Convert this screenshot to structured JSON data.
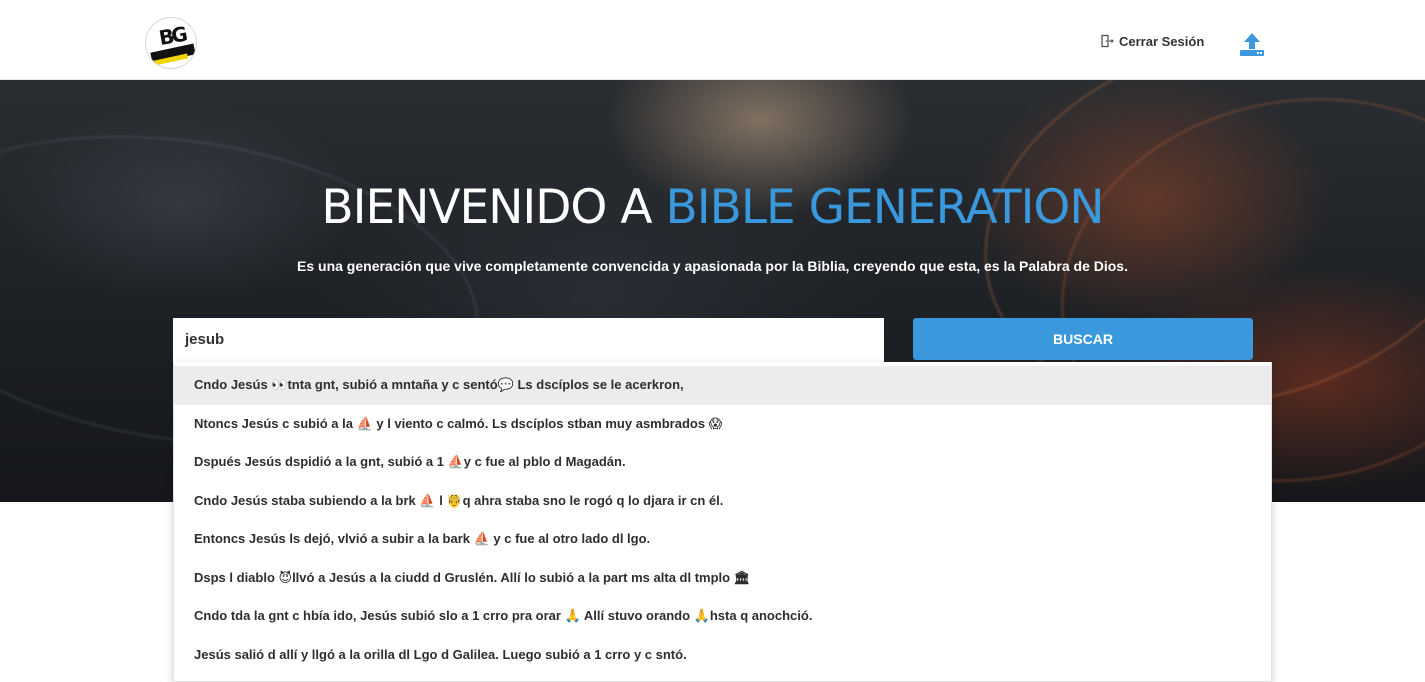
{
  "header": {
    "logo_text": "BG",
    "logout_label": "Cerrar Sesión",
    "logout_icon": "door-exit-icon",
    "upload_icon": "cloud-upload-icon",
    "upload_color": "#3a98dd"
  },
  "hero": {
    "title_main": "BIENVENIDO A",
    "title_accent": "BIBLE GENERATION",
    "accent_color": "#3a98dd",
    "subtitle": "Es una generación que vive completamente convencida y apasionada por la Biblia, creyendo que esta, es la Palabra de Dios."
  },
  "search": {
    "value": "jesub",
    "button_label": "BUSCAR",
    "button_color": "#3a98dd"
  },
  "suggestions": [
    "Cndo Jesús 👀tnta gnt, subió a mntaña y c sentó💬   Ls dscíplos se le acerkron,",
    "Ntoncs Jesús c subió a la ⛵ y l viento c calmó. Ls dscíplos stban muy asmbrados 😱",
    "Dspués Jesús dspidió a la gnt, subió a 1 ⛵y c fue al pblo d Magadán.",
    "Cndo Jesús staba subiendo a la brk ⛵ l 🤴q ahra staba sno le rogó q lo djara ir cn él.",
    "Entoncs Jesús ls dejó, vlvió a subir a la bark ⛵ y c fue al otro lado dl lgo.",
    "Dsps l diablo 😈llvó a Jesús a la ciudd d Gruslén. Allí lo subió a la part ms alta dl tmplo 🏛",
    "Cndo tda la gnt c hbía ido, Jesús subió slo a 1 crro pra orar 🙏 Allí stuvo orando 🙏hsta q anochció.",
    "Jesús salió d allí y llgó a la orilla dl Lgo d Galilea. Luego subió a 1 crro y c sntó."
  ]
}
